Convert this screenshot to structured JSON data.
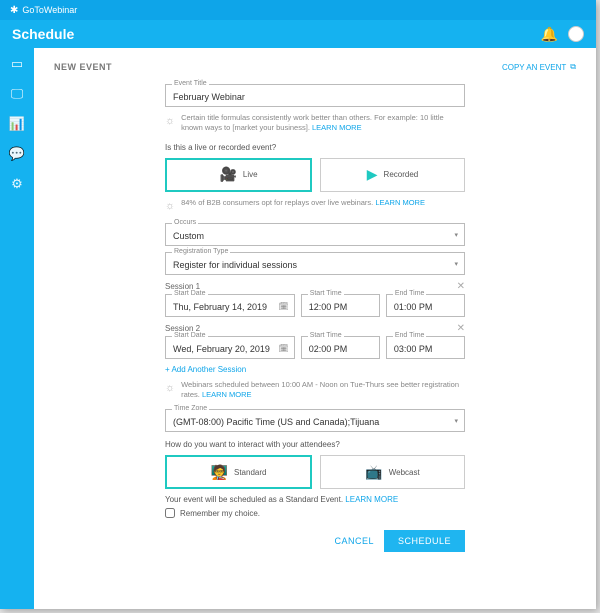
{
  "brand": "GoToWebinar",
  "header": {
    "title": "Schedule"
  },
  "page": {
    "newEvent": "NEW EVENT",
    "copy": "COPY AN EVENT"
  },
  "eventTitle": {
    "label": "Event Title",
    "value": "February Webinar"
  },
  "tip1": {
    "text": "Certain title formulas consistently work better than others. For example: 10 little known ways to [market your business].",
    "more": "LEARN MORE"
  },
  "liveQ": "Is this a live or recorded event?",
  "live": "Live",
  "recorded": "Recorded",
  "tip2": {
    "text": "84% of B2B consumers opt for replays over live webinars.",
    "more": "LEARN MORE"
  },
  "occurs": {
    "label": "Occurs",
    "value": "Custom"
  },
  "regType": {
    "label": "Registration Type",
    "value": "Register for individual sessions"
  },
  "session1": {
    "title": "Session 1",
    "dateLabel": "Start Date",
    "date": "Thu, February 14, 2019",
    "startLabel": "Start Time",
    "start": "12:00 PM",
    "endLabel": "End Time",
    "end": "01:00 PM"
  },
  "session2": {
    "title": "Session 2",
    "dateLabel": "Start Date",
    "date": "Wed, February 20, 2019",
    "startLabel": "Start Time",
    "start": "02:00 PM",
    "endLabel": "End Time",
    "end": "03:00 PM"
  },
  "addSession": "+ Add Another Session",
  "tip3": {
    "text": "Webinars scheduled between 10:00 AM - Noon on Tue-Thurs see better registration rates.",
    "more": "LEARN MORE"
  },
  "tz": {
    "label": "Time Zone",
    "value": "(GMT-08:00) Pacific Time (US and Canada);Tijuana"
  },
  "interactQ": "How do you want to interact with your attendees?",
  "standard": "Standard",
  "webcast": "Webcast",
  "stdLine": {
    "text": "Your event will be scheduled as a Standard Event.",
    "more": "LEARN MORE"
  },
  "remember": "Remember my choice.",
  "cancel": "CANCEL",
  "schedule": "SCHEDULE"
}
